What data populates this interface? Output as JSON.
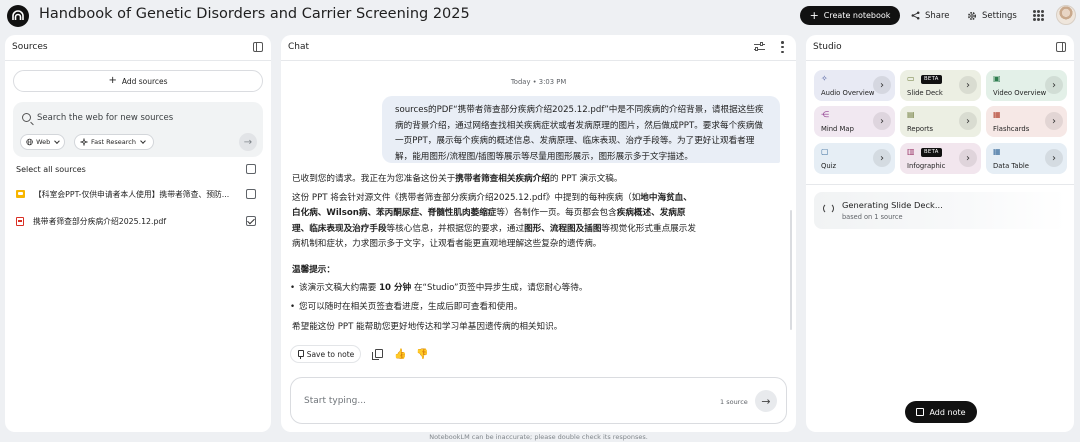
{
  "app": {
    "title": "Handbook of Genetic Disorders and Carrier Screening 2025",
    "create_label": "Create notebook",
    "share_label": "Share",
    "settings_label": "Settings"
  },
  "sources": {
    "title": "Sources",
    "add_label": "Add sources",
    "search_placeholder": "Search the web for new sources",
    "web_label": "Web",
    "research_label": "Fast Research",
    "select_all_label": "Select all sources",
    "items": [
      {
        "name": "【科室会PPT-仅供申请者本人使用】携带者筛查、预防...",
        "checked": false,
        "icon": "slides-icon"
      },
      {
        "name": "携带者筛查部分疾病介绍2025.12.pdf",
        "checked": true,
        "icon": "pdf-icon"
      }
    ]
  },
  "chat": {
    "title": "Chat",
    "timestamp": "Today • 3:03 PM",
    "user_message": "sources的PDF“携带者筛查部分疾病介绍2025.12.pdf”中是不同疾病的介绍背景，请根据这些疾病的背景介绍，通过网络查找相关疾病症状或者发病原理的图片，然后做成PPT。要求每个疾病做一页PPT，展示每个疾病的概述信息、发病原理、临床表现、治疗手段等。为了更好让观看者理解，能用图形/流程图/插图等展示等尽量用图形展示，图形展示多于文字描述。",
    "ai_para1": {
      "pre": "已收到您的请求。我正在为您准备这份关于",
      "bold": "携带者筛查相关疾病介绍",
      "post": "的 PPT 演示文稿。"
    },
    "ai_para2": {
      "t1": "这份 PPT 将会针对源文件《携带者筛查部分疾病介绍2025.12.pdf》中提到的每种疾病（如",
      "b1": "地中海贫血、白化病、Wilson病、苯丙酮尿症、脊髓性肌肉萎缩症",
      "t2": "等）各制作一页。每页都会包含",
      "b2": "疾病概述、发病原理、临床表现及治疗手段",
      "t3": "等核心信息，并根据您的要求，通过",
      "b3": "图形、流程图及插图",
      "t4": "等视觉化形式重点展示发病机制和症状，力求图示多于文字，让观看者能更直观地理解这些复杂的遗传病。"
    },
    "tips_title": "温馨提示：",
    "bullet1": {
      "pre": "该演示文稿大约需要 ",
      "bold": "10 分钟",
      "post": " 在“Studio”页签中异步生成，请您耐心等待。"
    },
    "bullet2": "您可以随时在相关页签查看进度，生成后即可查看和使用。",
    "closing": "希望能这份 PPT 能帮助您更好地传达和学习单基因遗传病的相关知识。",
    "save_note_label": "Save to note",
    "input_placeholder": "Start typing...",
    "source_count": "1 source",
    "footer": "NotebookLM can be inaccurate; please double check its responses."
  },
  "studio": {
    "title": "Studio",
    "beta_label": "BETA",
    "cards": [
      {
        "label": "Audio Overview",
        "icon": "audio-icon",
        "glyph": "✧",
        "bg": "#e8eaf4",
        "icon_color": "#4a5a9c",
        "beta": false
      },
      {
        "label": "Slide Deck",
        "icon": "slides-icon",
        "glyph": "▭",
        "bg": "#ecefe3",
        "icon_color": "#6d7a3a",
        "beta": true
      },
      {
        "label": "Video Overview",
        "icon": "video-icon",
        "glyph": "▣",
        "bg": "#e3f0e8",
        "icon_color": "#2e7d4f",
        "beta": false
      },
      {
        "label": "Mind Map",
        "icon": "mind-map-icon",
        "glyph": "⋲",
        "bg": "#f1e8f1",
        "icon_color": "#8e3a8e",
        "beta": false
      },
      {
        "label": "Reports",
        "icon": "reports-icon",
        "glyph": "▤",
        "bg": "#ecefe3",
        "icon_color": "#6d7a3a",
        "beta": false
      },
      {
        "label": "Flashcards",
        "icon": "flashcards-icon",
        "glyph": "▦",
        "bg": "#f6e8e6",
        "icon_color": "#b3412e",
        "beta": false
      },
      {
        "label": "Quiz",
        "icon": "quiz-icon",
        "glyph": "▢",
        "bg": "#e6eef5",
        "icon_color": "#3a6c9c",
        "beta": false
      },
      {
        "label": "Infographic",
        "icon": "infographic-icon",
        "glyph": "▥",
        "bg": "#f2e6ee",
        "icon_color": "#9c3a6c",
        "beta": true
      },
      {
        "label": "Data Table",
        "icon": "data-table-icon",
        "glyph": "▦",
        "bg": "#e6eef5",
        "icon_color": "#3a6c9c",
        "beta": false
      }
    ],
    "generating_title": "Generating Slide Deck...",
    "generating_sub": "based on 1 source",
    "add_note_label": "Add note"
  }
}
